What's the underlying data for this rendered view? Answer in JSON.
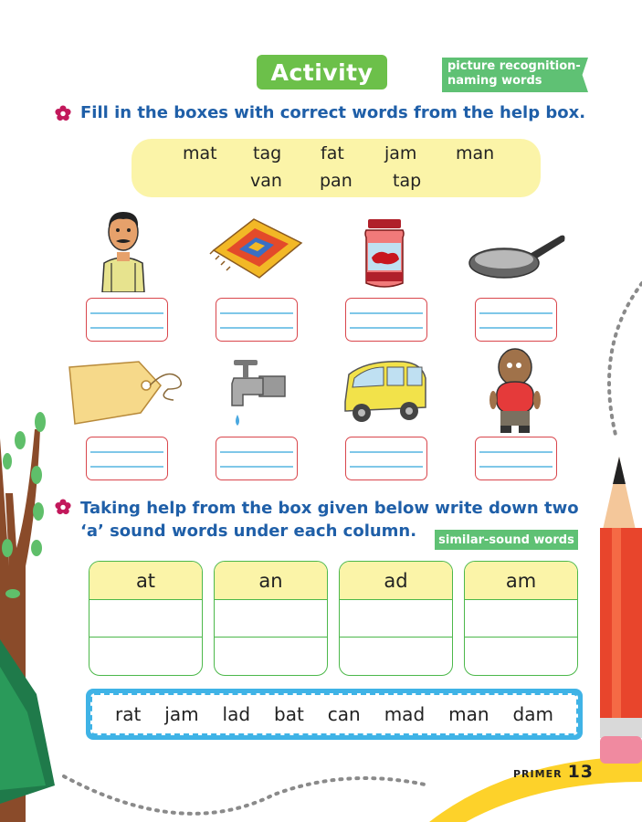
{
  "header": {
    "activity_label": "Activity",
    "tag_line1": "picture recognition-",
    "tag_line2": "naming words"
  },
  "section1": {
    "instruction": "Fill in the boxes with correct words from the help box.",
    "help_words_row1": [
      "mat",
      "tag",
      "fat",
      "jam",
      "man"
    ],
    "help_words_row2": [
      "van",
      "pan",
      "tap"
    ]
  },
  "pictures": {
    "row1": [
      "man-picture",
      "mat-picture",
      "jam-picture",
      "pan-picture"
    ],
    "row2": [
      "tag-picture",
      "tap-picture",
      "van-picture",
      "fat-picture"
    ]
  },
  "section2": {
    "instruction_line1": "Taking help from the box given below write down two",
    "instruction_line2": "‘a’ sound words under each column.",
    "badge": "similar-sound words",
    "columns": [
      "at",
      "an",
      "ad",
      "am"
    ],
    "words": [
      "rat",
      "jam",
      "lad",
      "bat",
      "can",
      "mad",
      "man",
      "dam"
    ]
  },
  "footer": {
    "book": "PRIMER",
    "page": "13"
  },
  "colors": {
    "green": "#6cc04a",
    "blue_text": "#1f5fa8",
    "yellow_box": "#fbf4a8",
    "red_border": "#d9464c",
    "strip_blue": "#3fb3e6"
  }
}
